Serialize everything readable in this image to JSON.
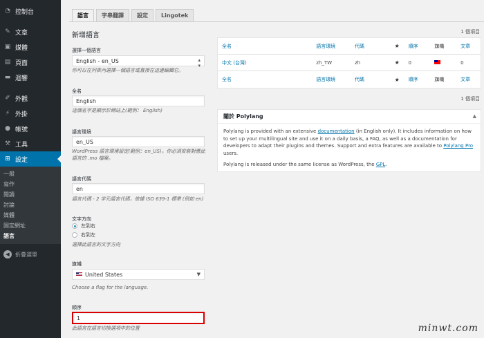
{
  "sidebar": {
    "items": [
      {
        "label": "控制台",
        "icon": "dashboard-icon"
      },
      {
        "label": "文章",
        "icon": "pin-icon"
      },
      {
        "label": "媒體",
        "icon": "media-icon"
      },
      {
        "label": "頁面",
        "icon": "page-icon"
      },
      {
        "label": "迴響",
        "icon": "comment-icon"
      },
      {
        "label": "外觀",
        "icon": "brush-icon"
      },
      {
        "label": "外掛",
        "icon": "plugin-icon"
      },
      {
        "label": "帳號",
        "icon": "user-icon"
      },
      {
        "label": "工具",
        "icon": "wrench-icon"
      },
      {
        "label": "設定",
        "icon": "settings-icon"
      }
    ],
    "submenu": [
      "一般",
      "寫作",
      "閱讀",
      "討論",
      "媒體",
      "固定網址",
      "語言"
    ],
    "collapse": "折疊選單"
  },
  "tabs": [
    "語言",
    "字串翻譯",
    "設定",
    "Lingotek"
  ],
  "form": {
    "title": "新增語言",
    "choose_label": "選擇一個語言",
    "choose_value": "English - en_US",
    "choose_desc": "你可以在列表內選擇一個語言或直接在這邊編輯它。",
    "name_label": "全名",
    "name_value": "English",
    "name_desc": "這個名字是顯示於網站上(範例： English)",
    "locale_label": "語言環境",
    "locale_value": "en_US",
    "locale_desc": "WordPress 語言環境設定(範例：en_US)。你必須安裝對應此語言的 .mo 檔案。",
    "code_label": "語言代碼",
    "code_value": "en",
    "code_desc": "語言代碼 - 2 字元語言代碼，依據 ISO 639-1 標準 (例如 en)",
    "dir_label": "文字方向",
    "dir_ltr": "左到右",
    "dir_rtl": "右到左",
    "dir_desc": "選擇此語言的文字方向",
    "flag_label": "旗幟",
    "flag_value": "United States",
    "flag_desc": "Choose a flag for the language.",
    "order_label": "順序",
    "order_value": "1",
    "order_desc": "此語言在語言切換選項中的位置"
  },
  "table": {
    "count": "1 個項目",
    "headers": [
      "全名",
      "語言環境",
      "代碼",
      "順序",
      "旗幟",
      "文章"
    ],
    "rows": [
      {
        "name": "中文 (台灣)",
        "locale": "zh_TW",
        "code": "zh",
        "order": "0",
        "posts": "0"
      }
    ]
  },
  "about": {
    "title": "關於 Polylang",
    "p1_a": "Polylang is provided with an extensive ",
    "p1_link": "documentation",
    "p1_b": " (in English only). It includes information on how to set up your multilingual site and use it on a daily basis, a FAQ, as well as a documentation for developers to adapt their plugins and themes. Support and extra features are available to ",
    "p1_link2": "Polylang Pro",
    "p1_c": " users.",
    "p2_a": "Polylang is released under the same license as WordPress, the ",
    "p2_link": "GPL",
    "p2_b": "."
  },
  "watermark": "minwt.com"
}
